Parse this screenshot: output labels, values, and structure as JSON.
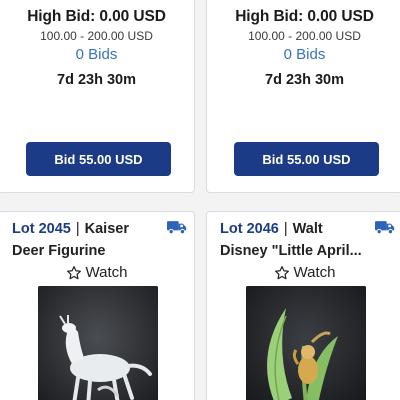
{
  "top_cards": [
    {
      "high_bid": "High Bid: 0.00 USD",
      "estimate": "100.00 - 200.00 USD",
      "bids": "0 Bids",
      "time_left": "7d 23h 30m",
      "bid_button": "Bid 55.00 USD"
    },
    {
      "high_bid": "High Bid: 0.00 USD",
      "estimate": "100.00 - 200.00 USD",
      "bids": "0 Bids",
      "time_left": "7d 23h 30m",
      "bid_button": "Bid 55.00 USD"
    }
  ],
  "bottom_cards": [
    {
      "lot": "Lot 2045",
      "separator": "|",
      "title_line1": "Kaiser",
      "title_line2": "Deer Figurine",
      "watch_label": "Watch",
      "shipping_icon": "truck-icon",
      "watch_icon": "star-outline-icon"
    },
    {
      "lot": "Lot 2046",
      "separator": "|",
      "title_line1": "Walt",
      "title_line2": "Disney \"Little April...",
      "watch_label": "Watch",
      "shipping_icon": "truck-icon",
      "watch_icon": "star-outline-icon"
    }
  ],
  "colors": {
    "accent": "#1c3b86",
    "link": "#3572c4",
    "card_bg": "#ffffff",
    "page_bg": "#f3f3f3"
  }
}
